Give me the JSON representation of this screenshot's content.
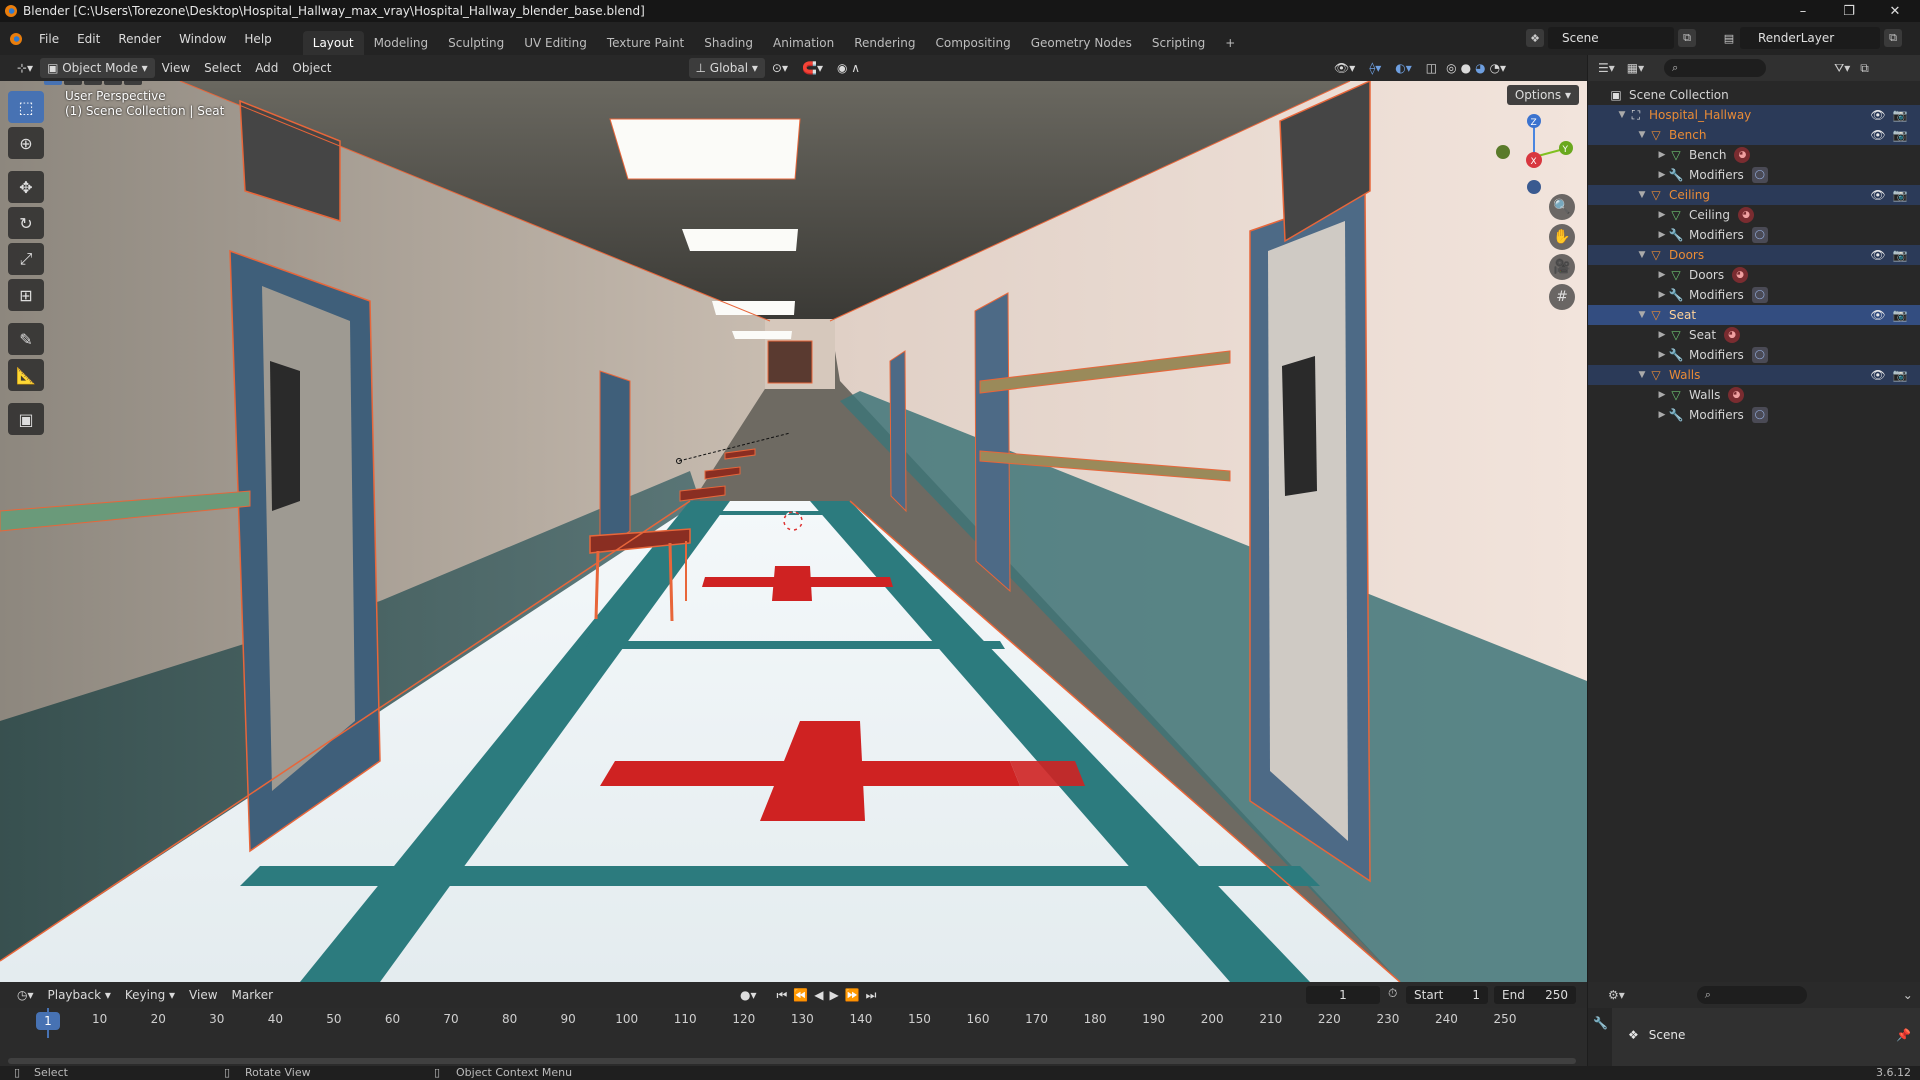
{
  "window": {
    "title": "Blender [C:\\Users\\Torezone\\Desktop\\Hospital_Hallway_max_vray\\Hospital_Hallway_blender_base.blend]",
    "controls": [
      "–",
      "❐",
      "✕"
    ]
  },
  "menu": [
    "File",
    "Edit",
    "Render",
    "Window",
    "Help"
  ],
  "workspaces": [
    "Layout",
    "Modeling",
    "Sculpting",
    "UV Editing",
    "Texture Paint",
    "Shading",
    "Animation",
    "Rendering",
    "Compositing",
    "Geometry Nodes",
    "Scripting",
    "+"
  ],
  "active_workspace": "Layout",
  "scene_name": "Scene",
  "render_layer": "RenderLayer",
  "viewport_header": {
    "mode": "Object Mode",
    "menus": [
      "View",
      "Select",
      "Add",
      "Object"
    ],
    "orientation": "Global"
  },
  "viewport": {
    "perspective": "User Perspective",
    "context": "(1) Scene Collection | Seat",
    "options": "Options",
    "gizmo": {
      "z": "Z",
      "y": "Y",
      "x": "X"
    }
  },
  "tools": [
    {
      "name": "select-box-tool",
      "glyph": "⬚",
      "active": true
    },
    {
      "name": "cursor-tool",
      "glyph": "⊕",
      "active": false
    },
    {
      "name": "move-tool",
      "glyph": "✥",
      "active": false
    },
    {
      "name": "rotate-tool",
      "glyph": "↻",
      "active": false
    },
    {
      "name": "scale-tool",
      "glyph": "⤢",
      "active": false
    },
    {
      "name": "transform-tool",
      "glyph": "⊞",
      "active": false
    },
    {
      "name": "annotate-tool",
      "glyph": "✎",
      "active": false
    },
    {
      "name": "measure-tool",
      "glyph": "📐",
      "active": false
    },
    {
      "name": "add-cube-tool",
      "glyph": "▣",
      "active": false
    }
  ],
  "outliner": {
    "root": "Scene Collection",
    "rows": [
      {
        "label": "Hospital_Hallway",
        "kind": "collection",
        "depth": 0,
        "expanded": true,
        "selected": true,
        "orange": true,
        "vis": true
      },
      {
        "label": "Bench",
        "kind": "object",
        "depth": 1,
        "expanded": true,
        "selected": true,
        "orange": true,
        "vis": true
      },
      {
        "label": "Bench",
        "kind": "mesh",
        "depth": 2,
        "expanded": false,
        "selected": false,
        "orange": false,
        "badge": "material"
      },
      {
        "label": "Modifiers",
        "kind": "modifier",
        "depth": 2,
        "expanded": false,
        "selected": false,
        "orange": false,
        "badge": "modifier"
      },
      {
        "label": "Ceiling",
        "kind": "object",
        "depth": 1,
        "expanded": true,
        "selected": true,
        "orange": true,
        "vis": true
      },
      {
        "label": "Ceiling",
        "kind": "mesh",
        "depth": 2,
        "expanded": false,
        "selected": false,
        "orange": false,
        "badge": "material"
      },
      {
        "label": "Modifiers",
        "kind": "modifier",
        "depth": 2,
        "expanded": false,
        "selected": false,
        "orange": false,
        "badge": "modifier"
      },
      {
        "label": "Doors",
        "kind": "object",
        "depth": 1,
        "expanded": true,
        "selected": true,
        "orange": true,
        "vis": true
      },
      {
        "label": "Doors",
        "kind": "mesh",
        "depth": 2,
        "expanded": false,
        "selected": false,
        "orange": false,
        "badge": "material"
      },
      {
        "label": "Modifiers",
        "kind": "modifier",
        "depth": 2,
        "expanded": false,
        "selected": false,
        "orange": false,
        "badge": "modifier"
      },
      {
        "label": "Seat",
        "kind": "object",
        "depth": 1,
        "expanded": true,
        "selected": true,
        "orange": false,
        "active": true,
        "vis": true
      },
      {
        "label": "Seat",
        "kind": "mesh",
        "depth": 2,
        "expanded": false,
        "selected": false,
        "orange": false,
        "badge": "material"
      },
      {
        "label": "Modifiers",
        "kind": "modifier",
        "depth": 2,
        "expanded": false,
        "selected": false,
        "orange": false,
        "badge": "modifier"
      },
      {
        "label": "Walls",
        "kind": "object",
        "depth": 1,
        "expanded": true,
        "selected": true,
        "orange": true,
        "vis": true
      },
      {
        "label": "Walls",
        "kind": "mesh",
        "depth": 2,
        "expanded": false,
        "selected": false,
        "orange": false,
        "badge": "material"
      },
      {
        "label": "Modifiers",
        "kind": "modifier",
        "depth": 2,
        "expanded": false,
        "selected": false,
        "orange": false,
        "badge": "modifier"
      }
    ]
  },
  "timeline": {
    "menus": [
      "Playback",
      "Keying",
      "View",
      "Marker"
    ],
    "current_frame": "1",
    "start_label": "Start",
    "start": "1",
    "end_label": "End",
    "end": "250",
    "ticks": [
      "10",
      "20",
      "30",
      "40",
      "50",
      "60",
      "70",
      "80",
      "90",
      "100",
      "110",
      "120",
      "130",
      "140",
      "150",
      "160",
      "170",
      "180",
      "190",
      "200",
      "210",
      "220",
      "230",
      "240",
      "250"
    ],
    "playhead": "1"
  },
  "properties": {
    "scene": "Scene"
  },
  "status": {
    "select": "Select",
    "rotate": "Rotate View",
    "context_menu": "Object Context Menu",
    "version": "3.6.12"
  },
  "colors": {
    "accent": "#4772b3",
    "selection_outline": "#e8663a",
    "selected_row": "#334d80",
    "collection_orange": "#e98b36"
  }
}
